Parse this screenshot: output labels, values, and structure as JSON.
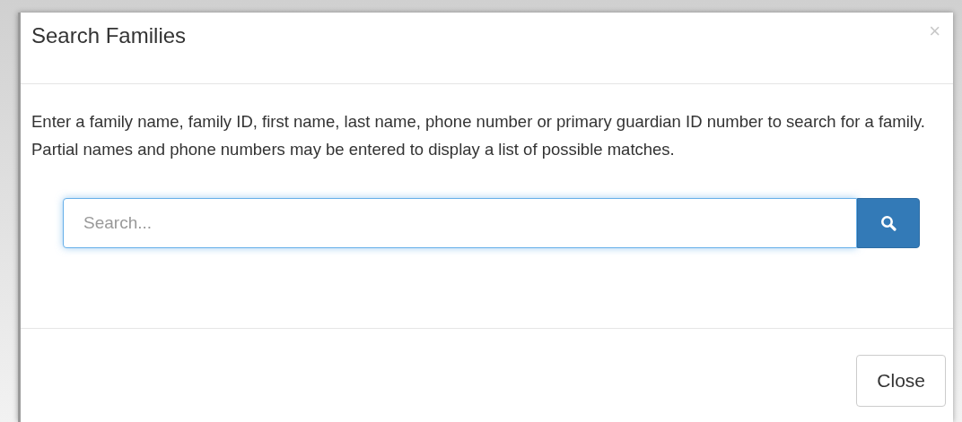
{
  "dialog": {
    "title": "Search Families",
    "close_glyph": "×",
    "description": "Enter a family name, family ID, first name, last name, phone number or primary guardian ID number to search for a family. Partial names and phone numbers may be entered to display a list of possible matches.",
    "search": {
      "placeholder": "Search..."
    },
    "buttons": [
      "Close"
    ]
  }
}
